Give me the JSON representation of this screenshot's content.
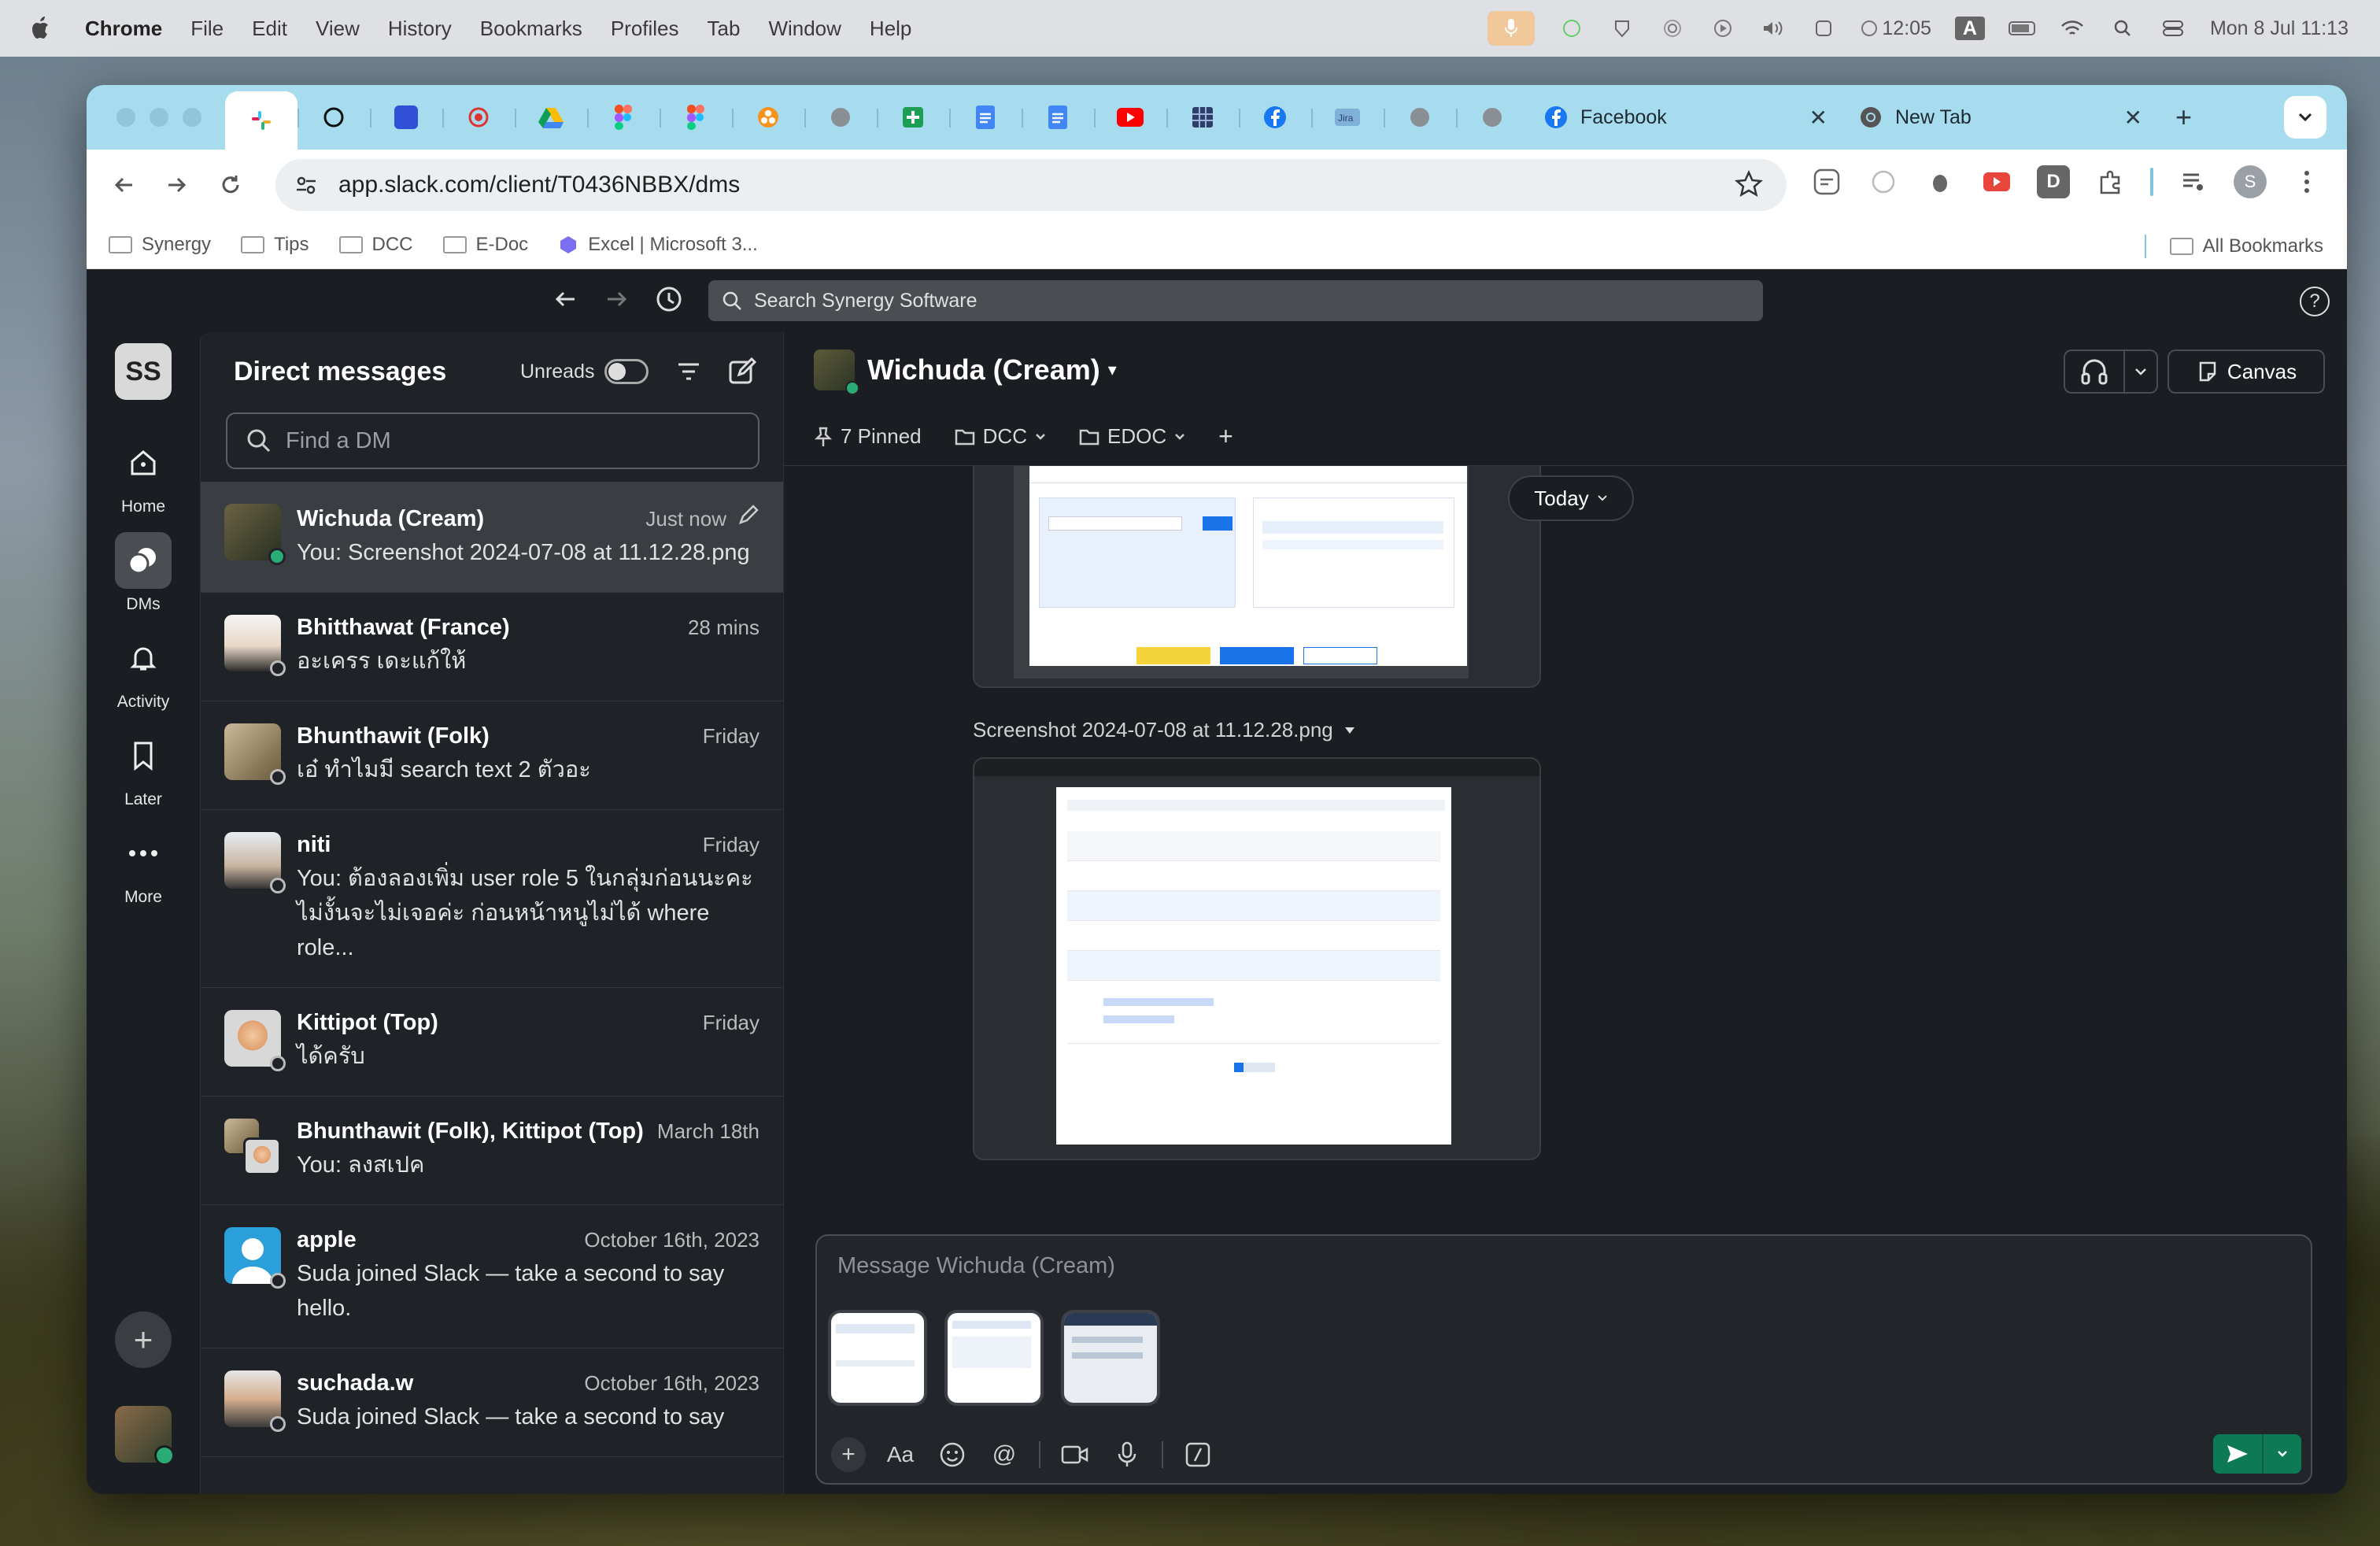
{
  "menubar": {
    "app": "Chrome",
    "items": [
      "File",
      "Edit",
      "View",
      "History",
      "Bookmarks",
      "Profiles",
      "Tab",
      "Window",
      "Help"
    ],
    "timer": "12:05",
    "input_source": "A",
    "datetime": "Mon 8 Jul  11:13"
  },
  "browser": {
    "tabs": [
      {
        "label": "Facebook"
      },
      {
        "label": "New Tab"
      }
    ],
    "url": "app.slack.com/client/T0436NBBX/dms",
    "bookmarks": [
      "Synergy",
      "Tips",
      "DCC",
      "E-Doc",
      "Excel | Microsoft 3..."
    ],
    "all_bookmarks": "All Bookmarks",
    "profile_initial": "S"
  },
  "slack": {
    "search_placeholder": "Search Synergy Software",
    "help": "?",
    "workspace_initials": "SS",
    "rail": [
      {
        "label": "Home"
      },
      {
        "label": "DMs"
      },
      {
        "label": "Activity"
      },
      {
        "label": "Later"
      },
      {
        "label": "More"
      }
    ],
    "sidebar": {
      "title": "Direct messages",
      "unreads_label": "Unreads",
      "find_placeholder": "Find a DM",
      "dms": [
        {
          "name": "Wichuda (Cream)",
          "time": "Just now",
          "message": "You: Screenshot 2024-07-08 at 11.12.28.png"
        },
        {
          "name": "Bhitthawat (France)",
          "time": "28 mins",
          "message": "อะเครร เดะแก้ให้"
        },
        {
          "name": "Bhunthawit (Folk)",
          "time": "Friday",
          "message": "เอ๋ ทำไมมี search text 2 ตัวอะ"
        },
        {
          "name": "niti",
          "time": "Friday",
          "message": "You: ต้องลองเพิ่ม user role 5 ในกลุ่มก่อนนะคะ ไม่งั้นจะไม่เจอค่ะ ก่อนหน้าหนูไม่ได้ where role..."
        },
        {
          "name": "Kittipot (Top)",
          "time": "Friday",
          "message": "ได้ครับ"
        },
        {
          "name": "Bhunthawit (Folk), Kittipot (Top)",
          "time": "March 18th",
          "message": "You: ลงสเปค"
        },
        {
          "name": "apple",
          "time": "October 16th, 2023",
          "message": "Suda joined Slack — take a second to say hello."
        },
        {
          "name": "suchada.w",
          "time": "October 16th, 2023",
          "message": "Suda joined Slack — take a second to say"
        }
      ]
    },
    "channel": {
      "name": "Wichuda (Cream)",
      "canvas_label": "Canvas",
      "bar": {
        "pinned": "7 Pinned",
        "folders": [
          "DCC",
          "EDOC"
        ],
        "add": "+"
      },
      "date_divider": "Today",
      "file_name": "Screenshot 2024-07-08 at 11.12.28.png",
      "composer_placeholder": "Message Wichuda (Cream)"
    }
  },
  "colors": {
    "slack_bg": "#1a1d21",
    "sidebar_bg": "#1f2227",
    "send_green": "#0e7a55",
    "presence_green": "#2bac76",
    "tabstrip": "#a7dcef"
  }
}
